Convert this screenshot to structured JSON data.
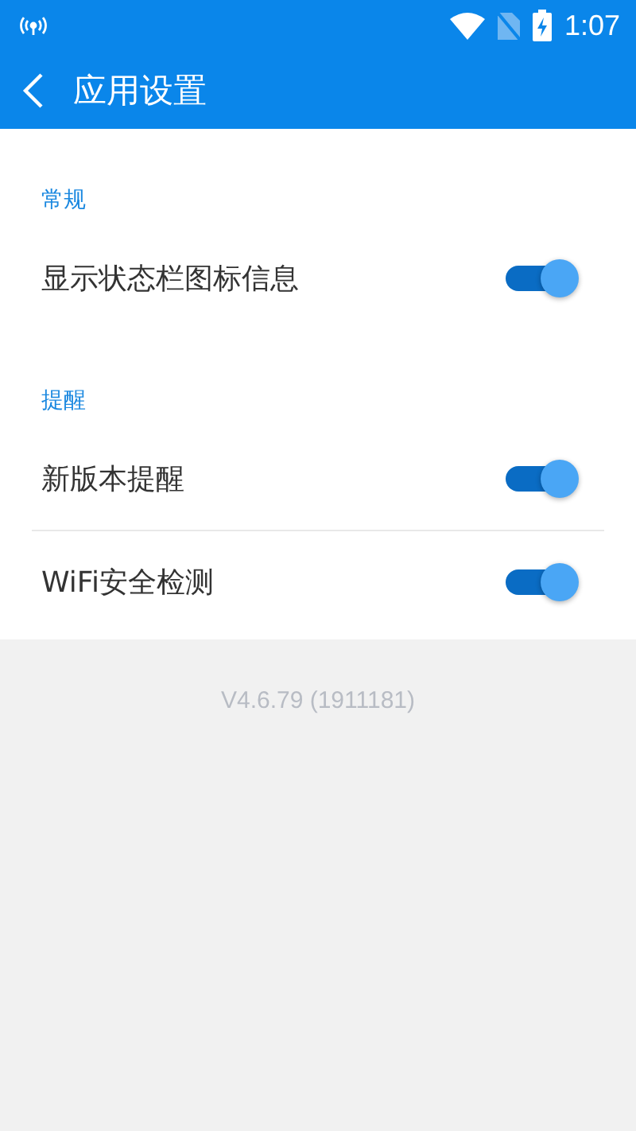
{
  "status_bar": {
    "time": "1:07"
  },
  "app_bar": {
    "title": "应用设置"
  },
  "sections": [
    {
      "header": "常规",
      "items": [
        {
          "label": "显示状态栏图标信息",
          "on": true
        }
      ]
    },
    {
      "header": "提醒",
      "items": [
        {
          "label": "新版本提醒",
          "on": true
        },
        {
          "label": "WiFi安全检测",
          "on": true
        }
      ]
    }
  ],
  "version": "V4.6.79 (1911181)"
}
